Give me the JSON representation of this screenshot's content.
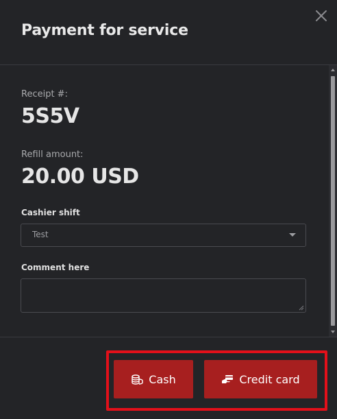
{
  "dialog": {
    "title": "Payment for service",
    "close_icon": "close-icon"
  },
  "receipt": {
    "label": "Receipt #:",
    "value": "5S5V"
  },
  "refill": {
    "label": "Refill amount:",
    "value": "20.00 USD"
  },
  "cashier_shift": {
    "label": "Cashier shift",
    "selected": "Test"
  },
  "comment": {
    "label": "Comment here",
    "value": ""
  },
  "actions": {
    "cash_label": "Cash",
    "cash_icon": "coins-stack-icon",
    "card_label": "Credit card",
    "card_icon": "credit-card-hand-icon"
  },
  "colors": {
    "background": "#232427",
    "button": "#a71f1f",
    "highlight": "#e3101a"
  }
}
